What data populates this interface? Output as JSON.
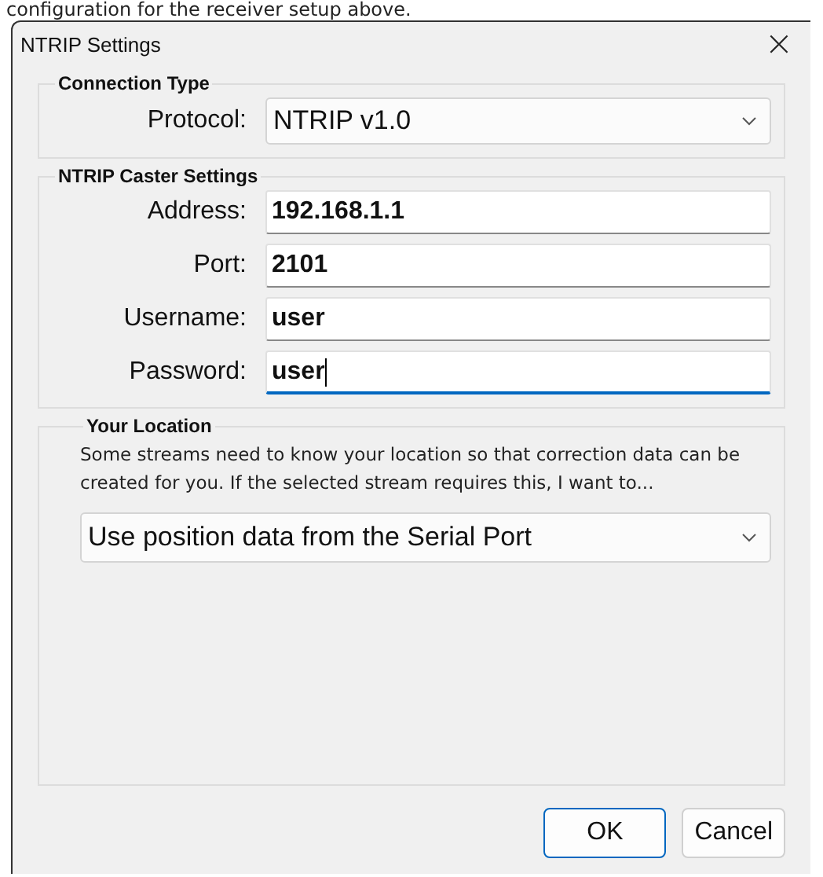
{
  "background_text": "configuration for the receiver setup above.",
  "window": {
    "title": "NTRIP Settings",
    "close": "×"
  },
  "connection_type": {
    "title": "Connection Type",
    "protocol_label": "Protocol:",
    "protocol_value": "NTRIP v1.0"
  },
  "caster_settings": {
    "title": "NTRIP Caster Settings",
    "fields": [
      {
        "label": "Address:",
        "value": "192.168.1.1",
        "focused": false
      },
      {
        "label": "Port:",
        "value": "2101",
        "focused": false
      },
      {
        "label": "Username:",
        "value": "user",
        "focused": false
      },
      {
        "label": "Password:",
        "value": "user",
        "focused": true
      }
    ]
  },
  "your_location": {
    "title": "Your Location",
    "description": "Some streams need to know your location so that correction data can be created for you. If the selected stream requires this, I want to...",
    "value": "Use position data from the Serial Port"
  },
  "buttons": [
    {
      "label": "OK",
      "default": true
    },
    {
      "label": "Cancel",
      "default": false
    }
  ]
}
